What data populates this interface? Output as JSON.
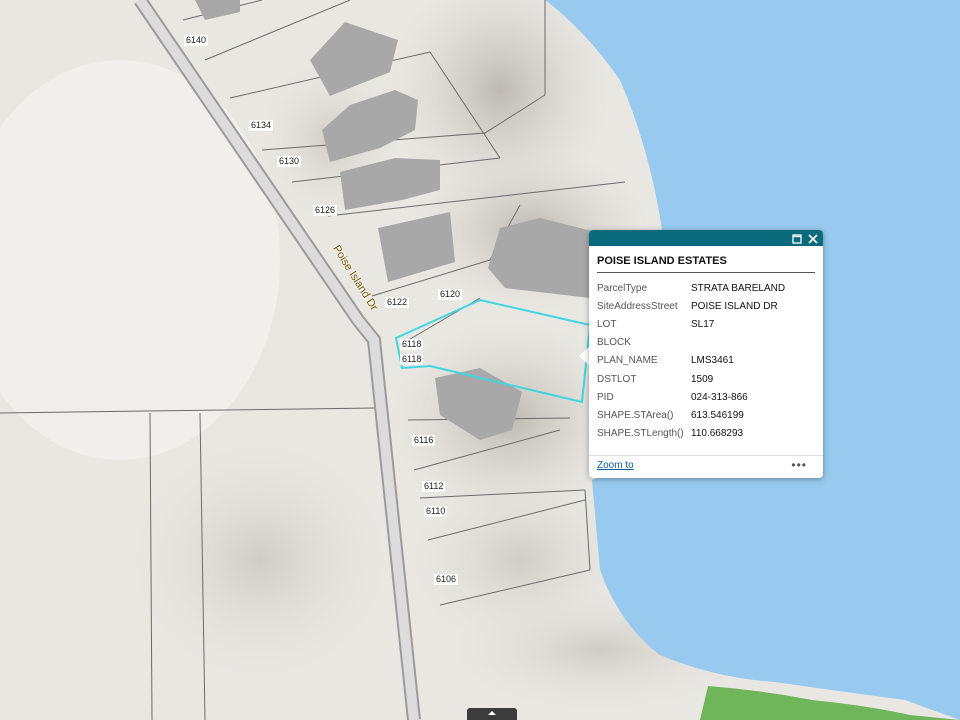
{
  "map": {
    "road_name": "Poise Island Dr",
    "address_labels": [
      "6140",
      "6134",
      "6130",
      "6126",
      "6122",
      "6120",
      "6118",
      "6118",
      "6116",
      "6112",
      "6110",
      "6106"
    ],
    "colors": {
      "water": "#97caee",
      "land": "#e9e7e2",
      "parcel_lines": "#666666",
      "buildings": "#a8a8a8",
      "selection": "#3fd6e0",
      "park": "#6fb55a"
    }
  },
  "popup": {
    "title": "POISE ISLAND ESTATES",
    "maximize_icon": "maximize-icon",
    "close_icon": "close-icon",
    "attributes": [
      {
        "name": "ParcelType",
        "value": "STRATA BARELAND"
      },
      {
        "name": "SiteAddressStreet",
        "value": "POISE ISLAND DR"
      },
      {
        "name": "LOT",
        "value": "SL17"
      },
      {
        "name": "BLOCK",
        "value": ""
      },
      {
        "name": "PLAN_NAME",
        "value": "LMS3461"
      },
      {
        "name": "DSTLOT",
        "value": "1509"
      },
      {
        "name": "PID",
        "value": "024-313-866"
      },
      {
        "name": "SHAPE.STArea()",
        "value": "613.546199"
      },
      {
        "name": "SHAPE.STLength()",
        "value": "110.668293"
      }
    ],
    "zoom_link": "Zoom to",
    "more_icon": "more-icon"
  },
  "footer": {
    "expand_icon": "chevron-up-icon"
  }
}
